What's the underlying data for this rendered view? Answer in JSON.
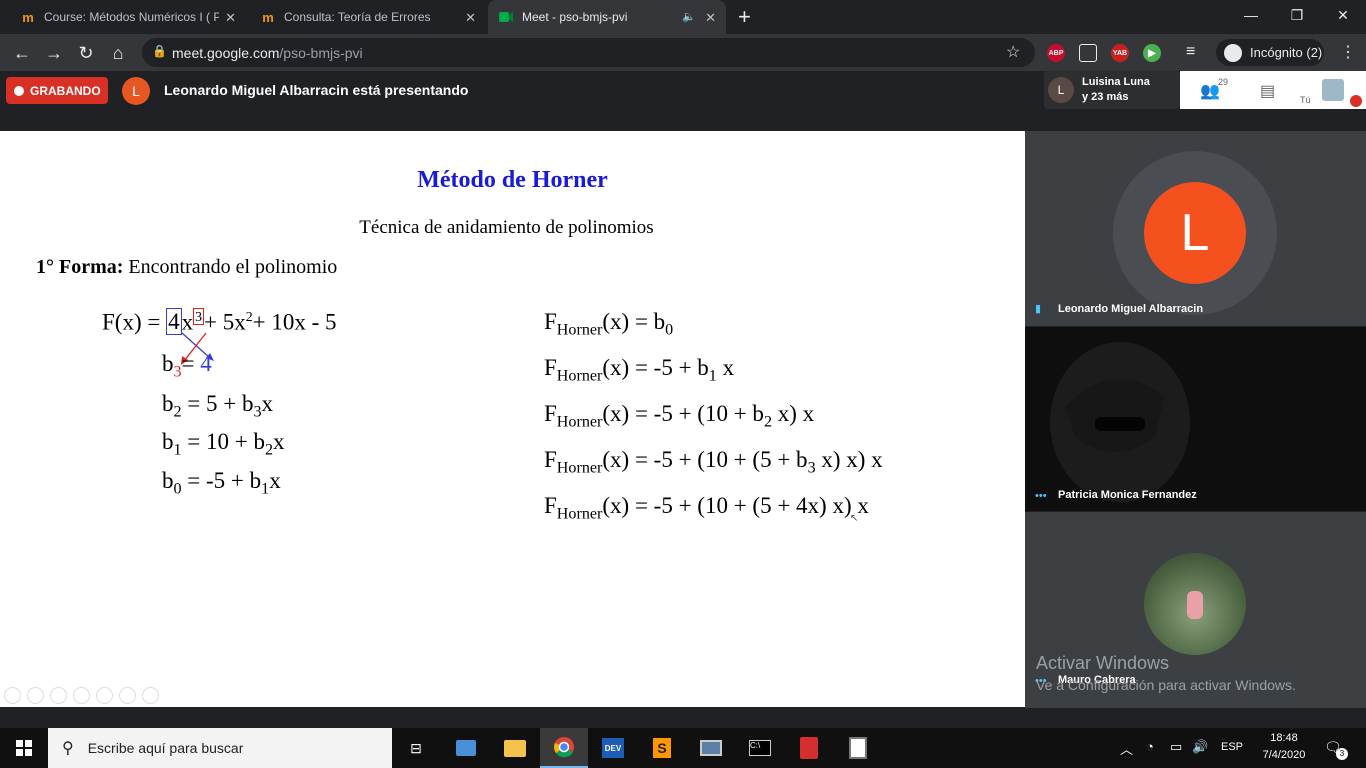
{
  "browser": {
    "tabs": [
      {
        "title": "Course: Métodos Numéricos I ( P",
        "active": false
      },
      {
        "title": "Consulta: Teoría de Errores",
        "active": false
      },
      {
        "title": "Meet - pso-bmjs-pvi",
        "active": true
      }
    ],
    "new_tab": "+",
    "address": {
      "host": "meet.google.com",
      "path": "/pso-bmjs-pvi"
    },
    "extensions": [
      "ABP",
      "YAB"
    ],
    "incognito_label": "Incógnito (2)"
  },
  "meet": {
    "recording_label": "GRABANDO",
    "presenter_initial": "L",
    "presenting_text": "Leonardo Miguel Albarracin está presentando",
    "participants_line1": "Luisina Luna",
    "participants_line2": "y 23 más",
    "participant_count": "29",
    "you_label": "Tú",
    "tiles": [
      {
        "name": "Leonardo Miguel Albarracin",
        "initial": "L"
      },
      {
        "name": "Patricia Monica Fernandez"
      },
      {
        "name": "Mauro Cabrera"
      }
    ],
    "windows_watermark_1": "Activar Windows",
    "windows_watermark_2": "Ve a Configuración para activar Windows."
  },
  "slide": {
    "title": "Método de Horner",
    "subtitle": "Técnica de anidamiento de polinomios",
    "form_label": "1° Forma:",
    "form_text": "Encontrando el polinomio",
    "colors": {
      "title": "#1a1adb",
      "blue_box": "#3340d8",
      "red_box": "#e02020"
    }
  },
  "taskbar": {
    "search_placeholder": "Escribe aquí para buscar",
    "lang": "ESP",
    "time": "18:48",
    "date": "7/4/2020",
    "notifications": "3"
  }
}
